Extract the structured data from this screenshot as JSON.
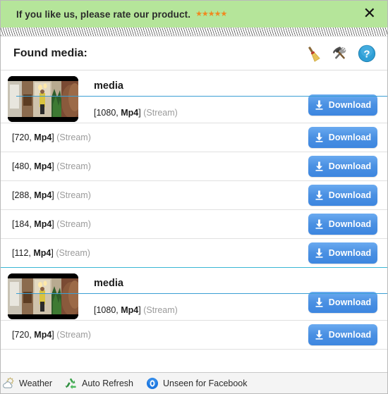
{
  "banner": {
    "text": "If you like us, please rate our product.",
    "stars": "★★★★★",
    "star_color": "#f0881f",
    "close_label": "✕",
    "bg_color": "#b5e59a"
  },
  "toolbar": {
    "title": "Found media:",
    "icons": [
      {
        "name": "broom-icon",
        "tooltip": "Clear"
      },
      {
        "name": "tools-icon",
        "tooltip": "Tools"
      },
      {
        "name": "help-icon",
        "tooltip": "Help"
      }
    ]
  },
  "accent_color": "#4a90e2",
  "group_rule_color": "#3bb7d4",
  "title_rule_color": "#3b9fd4",
  "download_label": "Download",
  "groups": [
    {
      "title": "media",
      "thumbnail_alt": "video-thumbnail",
      "items": [
        {
          "res": "[1080,",
          "fmt": "Mp4",
          "close": "]",
          "stream": "(Stream)"
        },
        {
          "res": "[720,",
          "fmt": "Mp4",
          "close": "]",
          "stream": "(Stream)"
        },
        {
          "res": "[480,",
          "fmt": "Mp4",
          "close": "]",
          "stream": "(Stream)"
        },
        {
          "res": "[288,",
          "fmt": "Mp4",
          "close": "]",
          "stream": "(Stream)"
        },
        {
          "res": "[184,",
          "fmt": "Mp4",
          "close": "]",
          "stream": "(Stream)"
        },
        {
          "res": "[112,",
          "fmt": "Mp4",
          "close": "]",
          "stream": "(Stream)"
        }
      ]
    },
    {
      "title": "media",
      "thumbnail_alt": "video-thumbnail",
      "items": [
        {
          "res": "[1080,",
          "fmt": "Mp4",
          "close": "]",
          "stream": "(Stream)"
        },
        {
          "res": "[720,",
          "fmt": "Mp4",
          "close": "]",
          "stream": "(Stream)"
        }
      ]
    }
  ],
  "statusbar": {
    "items": [
      {
        "icon": "weather-icon",
        "label": "Weather"
      },
      {
        "icon": "recycle-icon",
        "label": "Auto Refresh"
      },
      {
        "icon": "unseen-facebook-icon",
        "label": "Unseen for Facebook"
      }
    ]
  }
}
